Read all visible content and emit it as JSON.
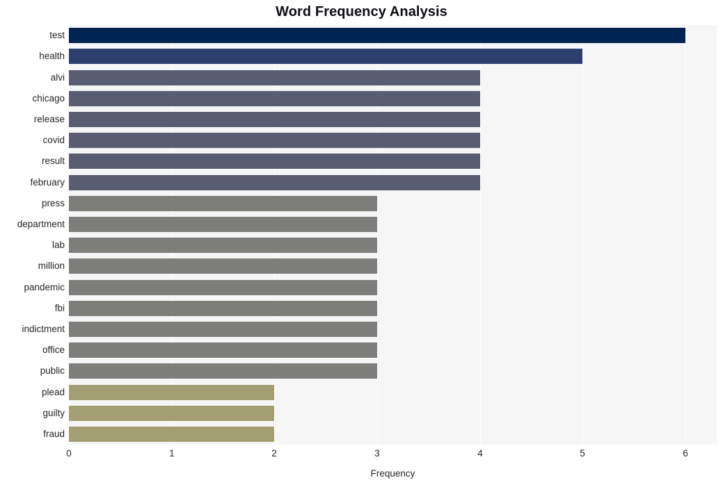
{
  "chart_data": {
    "type": "bar",
    "orientation": "horizontal",
    "title": "Word Frequency Analysis",
    "xlabel": "Frequency",
    "ylabel": "",
    "xlim": [
      0,
      6
    ],
    "xticks": [
      0,
      1,
      2,
      3,
      4,
      5,
      6
    ],
    "xtick_labels": [
      "0",
      "1",
      "2",
      "3",
      "4",
      "5",
      "6"
    ],
    "grid": true,
    "grid_axis": "x",
    "legend": "none",
    "categories": [
      "test",
      "health",
      "alvi",
      "chicago",
      "release",
      "covid",
      "result",
      "february",
      "press",
      "department",
      "lab",
      "million",
      "pandemic",
      "fbi",
      "indictment",
      "office",
      "public",
      "plead",
      "guilty",
      "fraud"
    ],
    "values": [
      6,
      5,
      4,
      4,
      4,
      4,
      4,
      4,
      3,
      3,
      3,
      3,
      3,
      3,
      3,
      3,
      3,
      2,
      2,
      2
    ],
    "bar_colors": [
      "#002451",
      "#2d3f6d",
      "#585d71",
      "#585d71",
      "#585d71",
      "#585d71",
      "#585d71",
      "#585d71",
      "#7d7d7a",
      "#7d7d7a",
      "#7d7d7a",
      "#7d7d7a",
      "#7d7d7a",
      "#7d7d7a",
      "#7d7d7a",
      "#7d7d7a",
      "#7d7d7a",
      "#a39e74",
      "#a39e74",
      "#a39e74"
    ]
  },
  "style": {
    "figure_background": "#ffffff",
    "plot_background": "#f6f6f7",
    "gridline_color": "#ffffff",
    "title_color": "#0d0d14",
    "tick_label_color": "#262626"
  }
}
